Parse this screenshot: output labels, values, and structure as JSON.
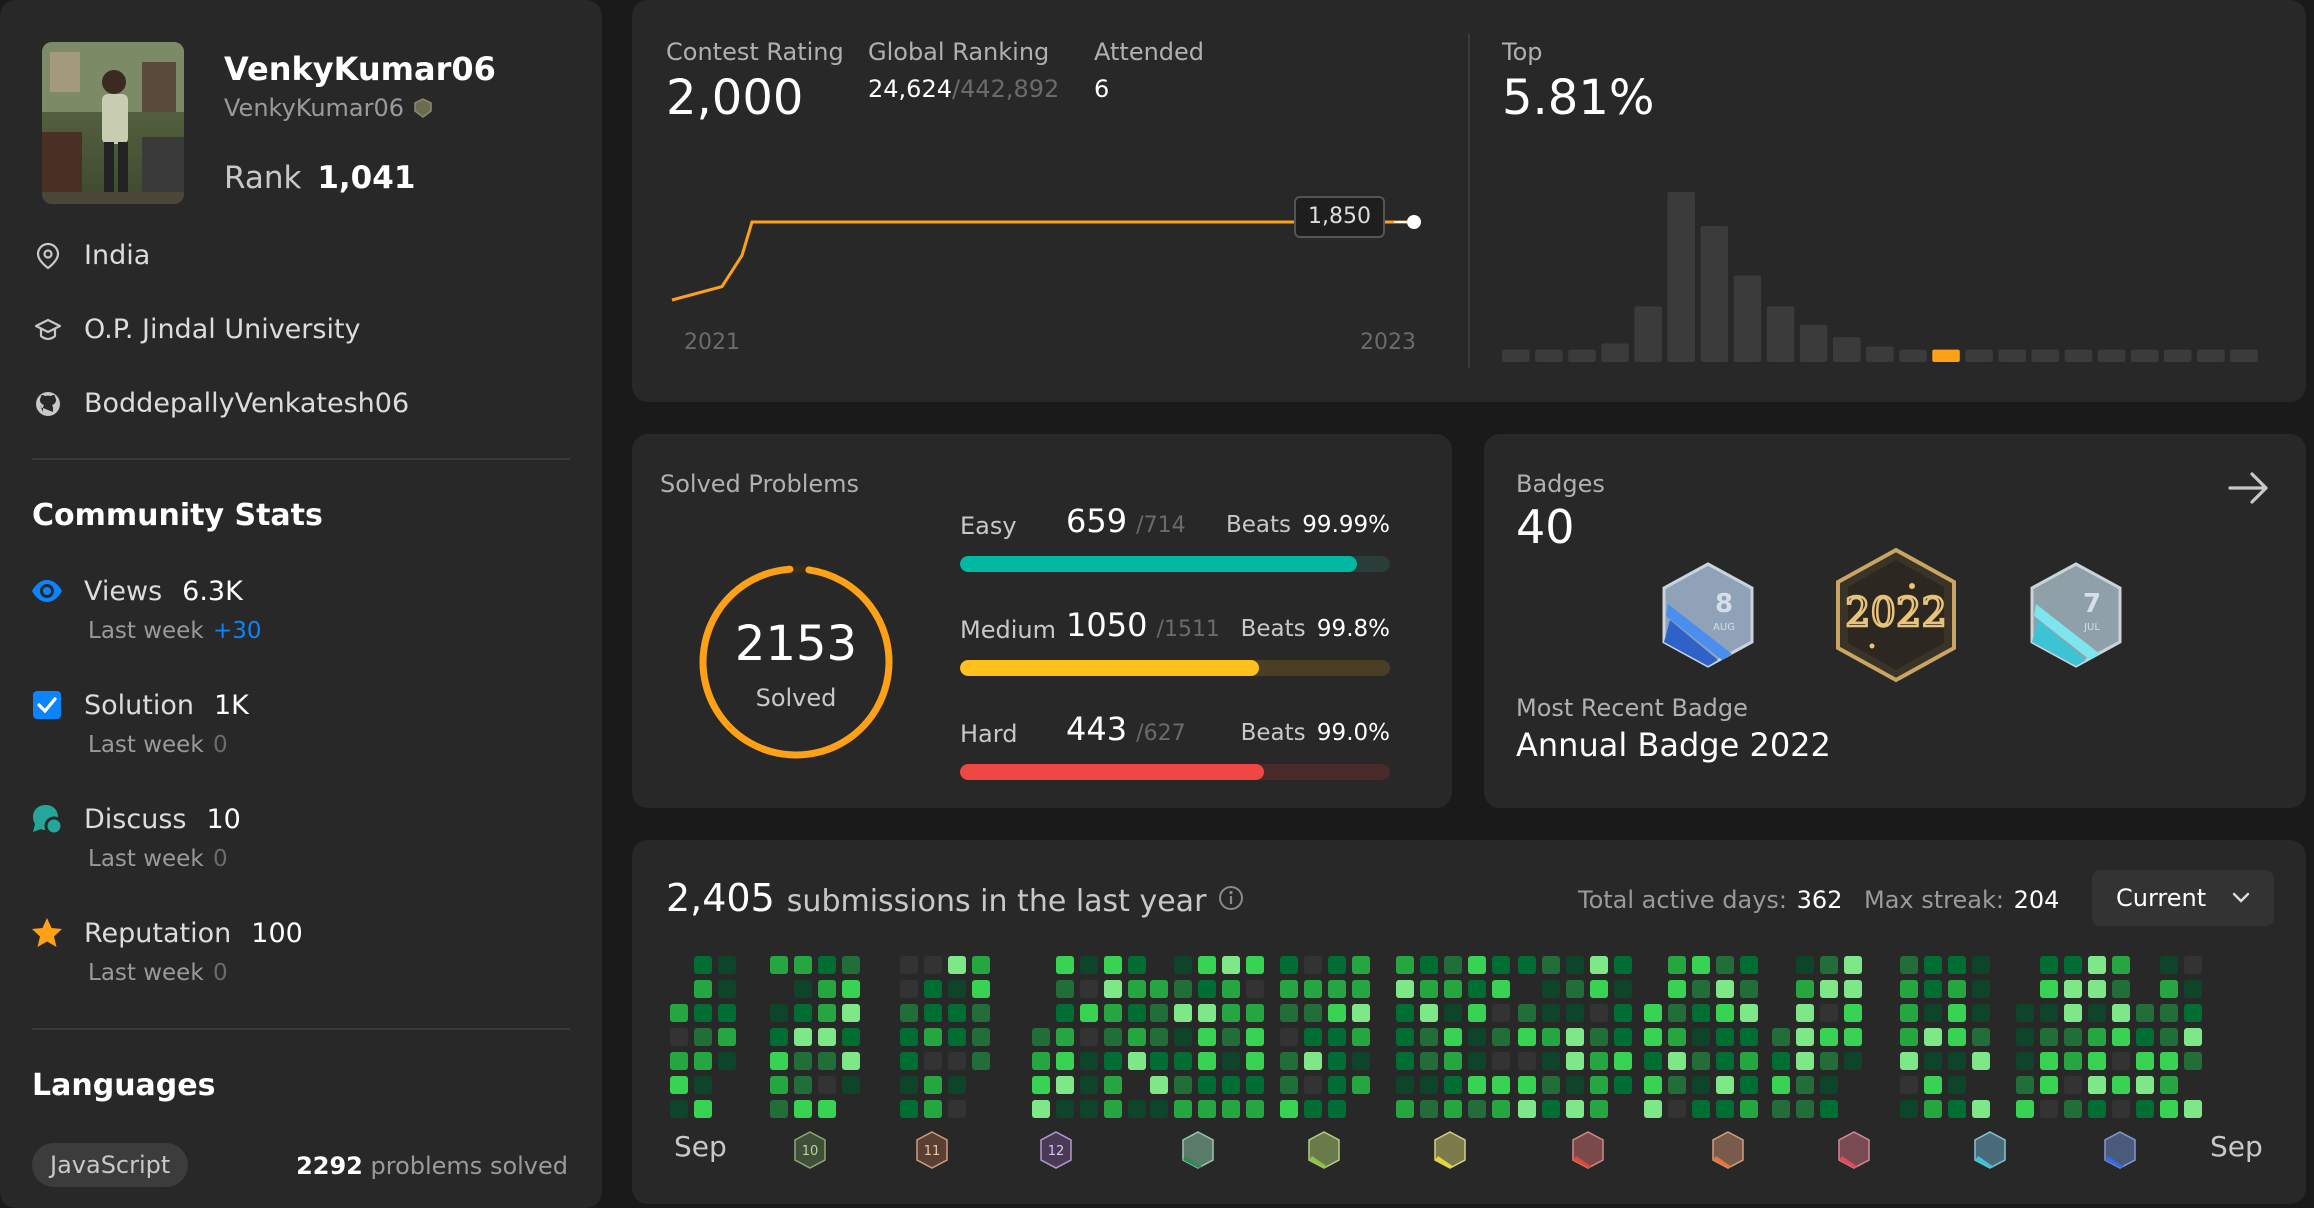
{
  "profile": {
    "display_name": "VenkyKumar06",
    "username": "VenkyKumar06",
    "rank_label": "Rank",
    "rank_value": "1,041",
    "location": "India",
    "school": "O.P. Jindal University",
    "github": "BoddepallyVenkatesh06"
  },
  "community": {
    "title": "Community Stats",
    "last_week_label": "Last week",
    "items": [
      {
        "label": "Views",
        "value": "6.3K",
        "last_week": "+30",
        "icon": "eye-icon",
        "color": "#0a84ff"
      },
      {
        "label": "Solution",
        "value": "1K",
        "last_week": "0",
        "icon": "checkbox-icon",
        "color": "#0a84ff"
      },
      {
        "label": "Discuss",
        "value": "10",
        "last_week": "0",
        "icon": "discuss-bubble-icon",
        "color": "#26a69a"
      },
      {
        "label": "Reputation",
        "value": "100",
        "last_week": "0",
        "icon": "star-icon",
        "color": "#ffa116"
      }
    ]
  },
  "languages": {
    "title": "Languages",
    "items": [
      {
        "name": "JavaScript",
        "count": "2292",
        "suffix": "problems solved"
      }
    ]
  },
  "contest": {
    "rating_label": "Contest Rating",
    "rating": "2,000",
    "global_label": "Global Ranking",
    "global_rank": "24,624",
    "global_total": "/442,892",
    "attended_label": "Attended",
    "attended": "6",
    "top_label": "Top",
    "top_value": "5.81%",
    "tooltip": "1,850",
    "x_start": "2021",
    "x_end": "2023",
    "accent": "#ffa116"
  },
  "chart_data": [
    {
      "type": "line",
      "x": [
        "2021",
        "",
        "",
        "",
        "",
        "2023"
      ],
      "series": [
        {
          "values": [
            1500,
            1560,
            1700,
            1850,
            1850,
            1850
          ]
        }
      ],
      "xlabel": "",
      "ylabel": "",
      "grid": false
    },
    {
      "type": "bar",
      "values": [
        4,
        4,
        4,
        6,
        18,
        55,
        44,
        28,
        18,
        12,
        8,
        5,
        4,
        4,
        4,
        4,
        4,
        4,
        4,
        4,
        4,
        4,
        4
      ],
      "highlight_index": 13,
      "grid": false
    }
  ],
  "solved": {
    "title": "Solved Problems",
    "total": "2153",
    "total_label": "Solved",
    "beats_label": "Beats",
    "levels": [
      {
        "name": "Easy",
        "solved": "659",
        "total": "/714",
        "beats": "99.99%",
        "fraction": 0.923,
        "color": "#00b8a3",
        "track": "#2a3d38"
      },
      {
        "name": "Medium",
        "solved": "1050",
        "total": "/1511",
        "beats": "99.8%",
        "fraction": 0.695,
        "color": "#ffc01e",
        "track": "#4a3f22"
      },
      {
        "name": "Hard",
        "solved": "443",
        "total": "/627",
        "beats": "99.0%",
        "fraction": 0.707,
        "color": "#ef4743",
        "track": "#4a2a2a"
      }
    ]
  },
  "badges": {
    "title": "Badges",
    "count": "40",
    "recent_label": "Most Recent Badge",
    "recent_name": "Annual Badge 2022"
  },
  "submissions": {
    "count": "2,405",
    "suffix": "submissions in the last year",
    "active_label": "Total active days:",
    "active_value": "362",
    "streak_label": "Max streak:",
    "streak_value": "204",
    "dropdown": "Current",
    "month_start": "Sep",
    "month_end": "Sep"
  }
}
